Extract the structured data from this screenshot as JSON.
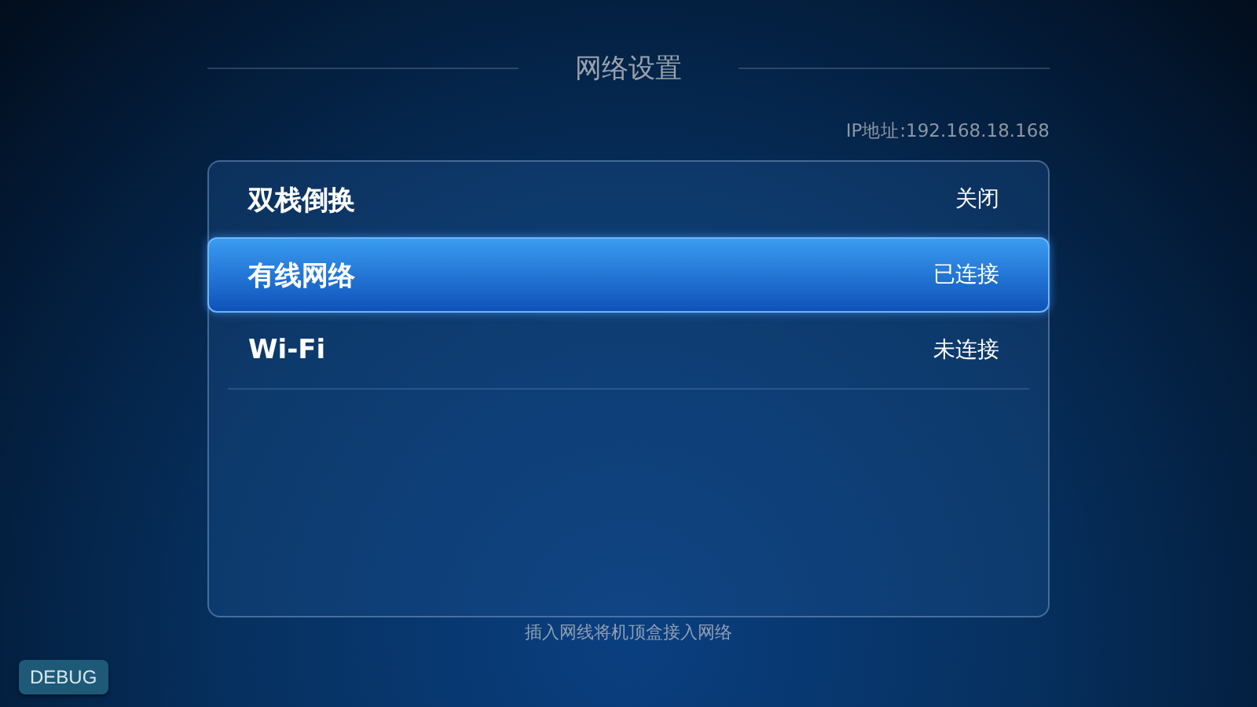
{
  "title": "网络设置",
  "ip_address": "IP地址:192.168.18.168",
  "items": [
    {
      "label": "双栈倒换",
      "value": "关闭",
      "selected": false
    },
    {
      "label": "有线网络",
      "value": "已连接",
      "selected": true
    },
    {
      "label": "Wi-Fi",
      "value": "未连接",
      "selected": false
    }
  ],
  "hint": "插入网线将机顶盒接入网络",
  "debug_button": "DEBUG"
}
